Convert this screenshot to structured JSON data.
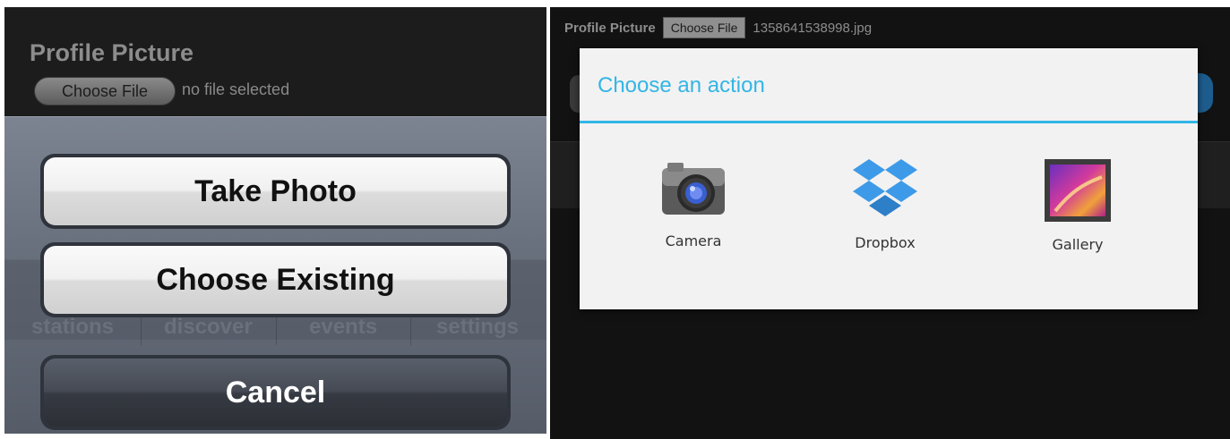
{
  "ios_screen": {
    "header": {
      "title": "Profile Picture",
      "choose_file_label": "Choose File",
      "file_status": "no file selected"
    },
    "background_tabs": [
      "stations",
      "discover",
      "events",
      "settings"
    ],
    "action_sheet": {
      "take_photo": "Take Photo",
      "choose_existing": "Choose Existing",
      "cancel": "Cancel"
    }
  },
  "android_screen": {
    "header": {
      "title": "Profile Picture",
      "choose_file_label": "Choose File",
      "file_name": "1358641538998.jpg"
    },
    "dialog": {
      "title": "Choose an action",
      "accent_color": "#33b5e5",
      "apps": [
        {
          "label": "Camera",
          "icon": "camera-icon"
        },
        {
          "label": "Dropbox",
          "icon": "dropbox-icon"
        },
        {
          "label": "Gallery",
          "icon": "gallery-icon"
        }
      ]
    }
  }
}
